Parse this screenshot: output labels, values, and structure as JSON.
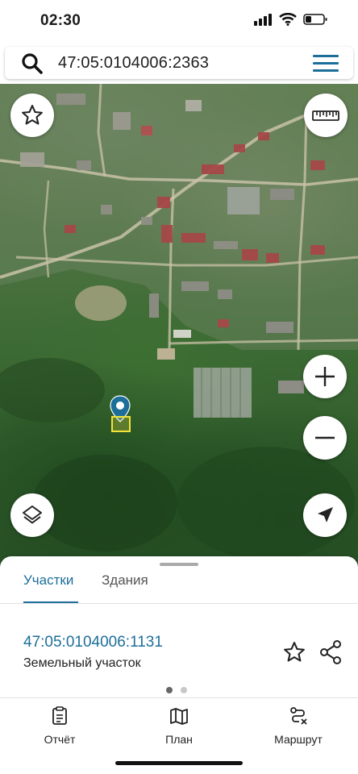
{
  "status": {
    "time": "02:30"
  },
  "search": {
    "value": "47:05:0104006:2363"
  },
  "sheet": {
    "tabs": [
      {
        "label": "Участки",
        "active": true
      },
      {
        "label": "Здания",
        "active": false
      }
    ],
    "parcel": {
      "number": "47:05:0104006:1131",
      "type": "Земельный участок"
    },
    "page_indicator": {
      "count": 2,
      "active": 1
    }
  },
  "bottom_nav": [
    {
      "label": "Отчёт",
      "icon": "report-icon"
    },
    {
      "label": "План",
      "icon": "map-plan-icon"
    },
    {
      "label": "Маршрут",
      "icon": "route-icon"
    }
  ],
  "map_controls": [
    "favorite-star-icon",
    "ruler-icon",
    "layers-icon",
    "zoom-in-icon",
    "zoom-out-icon",
    "locate-arrow-icon"
  ],
  "colors": {
    "accent": "#1d6f9a",
    "marker": "#1d6f9a",
    "plot_outline": "#f2e33a"
  }
}
